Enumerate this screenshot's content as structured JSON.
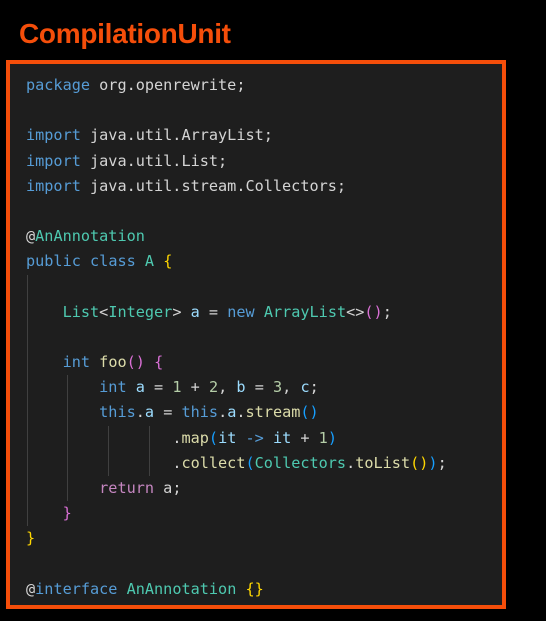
{
  "title": "CompilationUnit",
  "code": {
    "lines": [
      [
        {
          "t": "package",
          "c": "kw"
        },
        {
          "t": " org.openrewrite;",
          "c": "pl"
        }
      ],
      [],
      [
        {
          "t": "import",
          "c": "kw"
        },
        {
          "t": " java.util.ArrayList;",
          "c": "pl"
        }
      ],
      [
        {
          "t": "import",
          "c": "kw"
        },
        {
          "t": " java.util.List;",
          "c": "pl"
        }
      ],
      [
        {
          "t": "import",
          "c": "kw"
        },
        {
          "t": " java.util.stream.Collectors;",
          "c": "pl"
        }
      ],
      [],
      [
        {
          "t": "@",
          "c": "pl"
        },
        {
          "t": "AnAnnotation",
          "c": "ann"
        }
      ],
      [
        {
          "t": "public",
          "c": "kw"
        },
        {
          "t": " ",
          "c": "pl"
        },
        {
          "t": "class",
          "c": "kw"
        },
        {
          "t": " ",
          "c": "pl"
        },
        {
          "t": "A",
          "c": "type"
        },
        {
          "t": " ",
          "c": "pl"
        },
        {
          "t": "{",
          "c": "br1"
        }
      ],
      [],
      [
        {
          "t": "    ",
          "c": "pl"
        },
        {
          "t": "List",
          "c": "type"
        },
        {
          "t": "<",
          "c": "pl"
        },
        {
          "t": "Integer",
          "c": "type"
        },
        {
          "t": "> ",
          "c": "pl"
        },
        {
          "t": "a",
          "c": "var"
        },
        {
          "t": " = ",
          "c": "pl"
        },
        {
          "t": "new",
          "c": "kw"
        },
        {
          "t": " ",
          "c": "pl"
        },
        {
          "t": "ArrayList",
          "c": "type"
        },
        {
          "t": "<>",
          "c": "pl"
        },
        {
          "t": "()",
          "c": "br2"
        },
        {
          "t": ";",
          "c": "pl"
        }
      ],
      [],
      [
        {
          "t": "    ",
          "c": "pl"
        },
        {
          "t": "int",
          "c": "kw"
        },
        {
          "t": " ",
          "c": "pl"
        },
        {
          "t": "foo",
          "c": "fn"
        },
        {
          "t": "()",
          "c": "br2"
        },
        {
          "t": " ",
          "c": "pl"
        },
        {
          "t": "{",
          "c": "br2"
        }
      ],
      [
        {
          "t": "        ",
          "c": "pl"
        },
        {
          "t": "int",
          "c": "kw"
        },
        {
          "t": " ",
          "c": "pl"
        },
        {
          "t": "a",
          "c": "var"
        },
        {
          "t": " = ",
          "c": "pl"
        },
        {
          "t": "1",
          "c": "num"
        },
        {
          "t": " + ",
          "c": "pl"
        },
        {
          "t": "2",
          "c": "num"
        },
        {
          "t": ", ",
          "c": "pl"
        },
        {
          "t": "b",
          "c": "var"
        },
        {
          "t": " = ",
          "c": "pl"
        },
        {
          "t": "3",
          "c": "num"
        },
        {
          "t": ", ",
          "c": "pl"
        },
        {
          "t": "c",
          "c": "var"
        },
        {
          "t": ";",
          "c": "pl"
        }
      ],
      [
        {
          "t": "        ",
          "c": "pl"
        },
        {
          "t": "this",
          "c": "kw"
        },
        {
          "t": ".",
          "c": "pl"
        },
        {
          "t": "a",
          "c": "var"
        },
        {
          "t": " = ",
          "c": "pl"
        },
        {
          "t": "this",
          "c": "kw"
        },
        {
          "t": ".",
          "c": "pl"
        },
        {
          "t": "a",
          "c": "var"
        },
        {
          "t": ".",
          "c": "pl"
        },
        {
          "t": "stream",
          "c": "fn"
        },
        {
          "t": "()",
          "c": "br3"
        }
      ],
      [
        {
          "t": "                ",
          "c": "pl"
        },
        {
          "t": ".",
          "c": "pl"
        },
        {
          "t": "map",
          "c": "fn"
        },
        {
          "t": "(",
          "c": "br3"
        },
        {
          "t": "it",
          "c": "var"
        },
        {
          "t": " -> ",
          "c": "kw"
        },
        {
          "t": "it",
          "c": "var"
        },
        {
          "t": " + ",
          "c": "pl"
        },
        {
          "t": "1",
          "c": "num"
        },
        {
          "t": ")",
          "c": "br3"
        }
      ],
      [
        {
          "t": "                ",
          "c": "pl"
        },
        {
          "t": ".",
          "c": "pl"
        },
        {
          "t": "collect",
          "c": "fn"
        },
        {
          "t": "(",
          "c": "br3"
        },
        {
          "t": "Collectors",
          "c": "type"
        },
        {
          "t": ".",
          "c": "pl"
        },
        {
          "t": "toList",
          "c": "fn"
        },
        {
          "t": "()",
          "c": "br1"
        },
        {
          "t": ")",
          "c": "br3"
        },
        {
          "t": ";",
          "c": "pl"
        }
      ],
      [
        {
          "t": "        ",
          "c": "pl"
        },
        {
          "t": "return",
          "c": "ctl"
        },
        {
          "t": " a;",
          "c": "pl"
        }
      ],
      [
        {
          "t": "    ",
          "c": "pl"
        },
        {
          "t": "}",
          "c": "br2"
        }
      ],
      [
        {
          "t": "}",
          "c": "br1"
        }
      ],
      [],
      [
        {
          "t": "@",
          "c": "pl"
        },
        {
          "t": "interface",
          "c": "kw"
        },
        {
          "t": " ",
          "c": "pl"
        },
        {
          "t": "AnAnnotation",
          "c": "type"
        },
        {
          "t": " ",
          "c": "pl"
        },
        {
          "t": "{}",
          "c": "br1"
        }
      ]
    ]
  },
  "colors": {
    "accent": "#f54e0a",
    "editor_background": "#1e1e1e",
    "keyword": "#569cd6",
    "control_keyword": "#c586c0",
    "type": "#4ec9b0",
    "function": "#dcdcaa",
    "variable": "#9cdcfe",
    "number": "#b5cea8",
    "bracket_level_1": "#ffd700",
    "bracket_level_2": "#da70d6",
    "bracket_level_3": "#179fff"
  }
}
